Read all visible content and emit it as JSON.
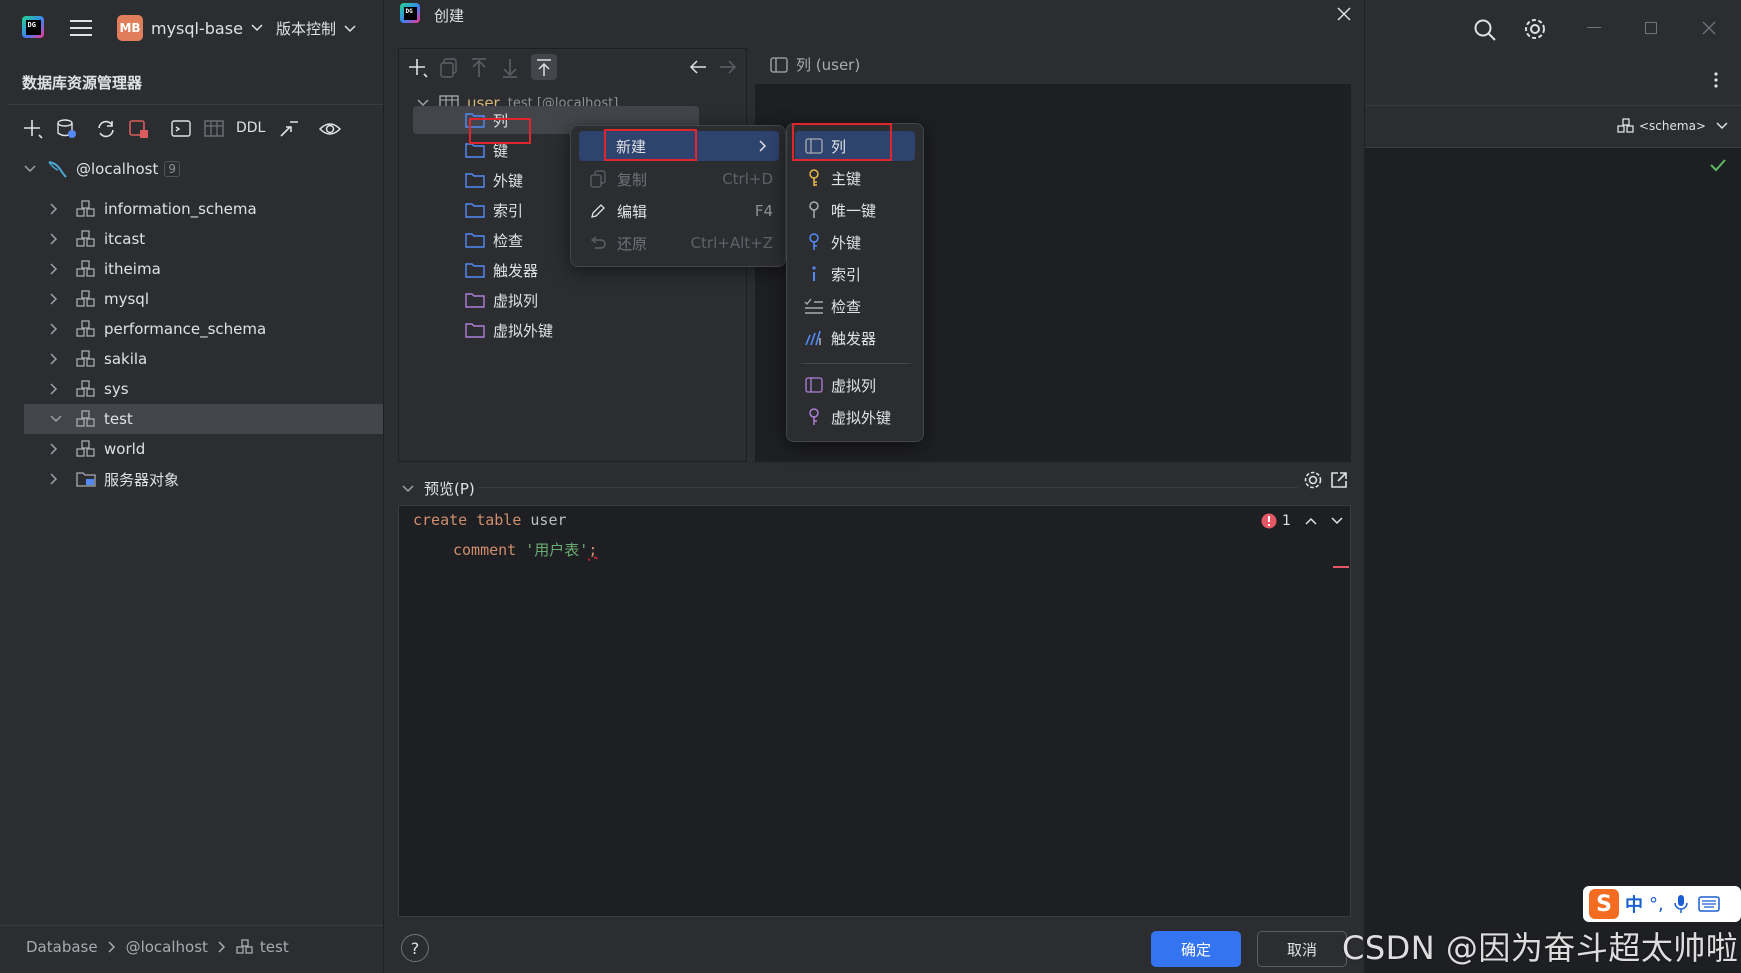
{
  "ide": {
    "project_badge": "MB",
    "project_name": "mysql-base",
    "vcs_menu": "版本控制",
    "explorer_title": "数据库资源管理器",
    "toolbar_ddl": "DDL",
    "connection": {
      "name": "@localhost",
      "count": "9"
    },
    "schemas": [
      "information_schema",
      "itcast",
      "itheima",
      "mysql",
      "performance_schema",
      "sakila",
      "sys",
      "test",
      "world",
      "服务器对象"
    ],
    "selected_schema": "test",
    "breadcrumb": [
      "Database",
      "@localhost",
      "test"
    ],
    "right_schema_label": "<schema>"
  },
  "dialog": {
    "title": "创建",
    "table": {
      "name": "user",
      "context": "test [@localhost]"
    },
    "folders": [
      "列",
      "键",
      "外键",
      "索引",
      "检查",
      "触发器",
      "虚拟列",
      "虚拟外键"
    ],
    "right_header": "列 (user)",
    "preview_label": "预览(P)",
    "error_count": "1",
    "sql": {
      "line1_kw1": "create",
      "line1_kw2": "table",
      "line1_name": "user",
      "line2_kw": "comment",
      "line2_str": "'用户表'",
      "line2_end": ";"
    },
    "ok_button": "确定",
    "cancel_button": "取消",
    "help": "?"
  },
  "context_menu": {
    "items": [
      {
        "label": "新建",
        "shortcut": "",
        "icon": "none",
        "disabled": false
      },
      {
        "label": "复制",
        "shortcut": "Ctrl+D",
        "icon": "copy-icon",
        "disabled": true
      },
      {
        "label": "编辑",
        "shortcut": "F4",
        "icon": "pencil-icon",
        "disabled": false
      },
      {
        "label": "还原",
        "shortcut": "Ctrl+Alt+Z",
        "icon": "undo-icon",
        "disabled": true
      }
    ]
  },
  "submenu": {
    "items": [
      "列",
      "主键",
      "唯一键",
      "外键",
      "索引",
      "检查",
      "触发器",
      "虚拟列",
      "虚拟外键"
    ]
  },
  "watermark": "CSDN @因为奋斗超太帅啦",
  "ime": {
    "lang": "中"
  },
  "colors": {
    "accent": "#3574f0",
    "highlight": "#2e436e",
    "annotation_red": "#e0262d",
    "keyword": "#cf8e6d",
    "string": "#6aab73",
    "table_name": "#d5b778"
  }
}
